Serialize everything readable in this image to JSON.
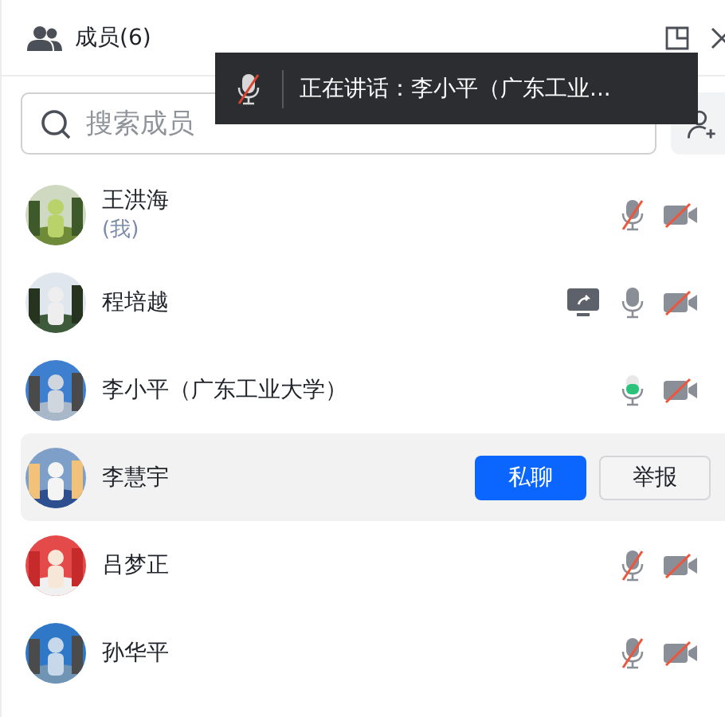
{
  "header": {
    "title": "成员(6)"
  },
  "speaking_banner": {
    "text": "正在讲话：李小平（广东工业...",
    "mic_muted": true
  },
  "search": {
    "placeholder": "搜索成员"
  },
  "members": [
    {
      "name": "王洪海",
      "note": "(我)",
      "mic_muted": true,
      "speaking": false,
      "camera_off": true,
      "sharing": false,
      "hovered": false
    },
    {
      "name": "程培越",
      "mic_muted": false,
      "speaking": false,
      "camera_off": true,
      "sharing": true,
      "hovered": false
    },
    {
      "name": "李小平（广东工业大学）",
      "mic_muted": false,
      "speaking": true,
      "camera_off": true,
      "sharing": false,
      "hovered": false
    },
    {
      "name": "李慧宇",
      "hovered": true,
      "actions": [
        {
          "label": "私聊",
          "kind": "primary"
        },
        {
          "label": "举报",
          "kind": "secondary"
        }
      ]
    },
    {
      "name": "吕梦正",
      "mic_muted": true,
      "speaking": false,
      "camera_off": true,
      "sharing": false,
      "hovered": false
    },
    {
      "name": "孙华平",
      "mic_muted": true,
      "speaking": false,
      "camera_off": true,
      "sharing": false,
      "hovered": false
    }
  ]
}
